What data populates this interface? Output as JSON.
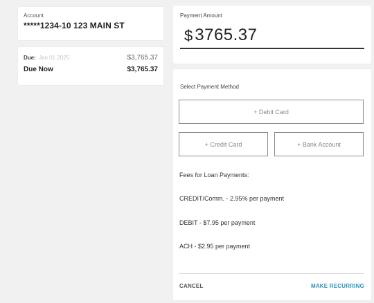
{
  "account": {
    "label": "Account",
    "value": "*****1234-10 123 MAIN ST"
  },
  "due": {
    "due_label": "Due:",
    "due_date": "Jan 01 2025",
    "due_amount": "$3,765.37",
    "due_now_label": "Due Now",
    "due_now_amount": "$3,765.37"
  },
  "payment_amount": {
    "label": "Payment Amount",
    "currency": "$",
    "value": "3765.37"
  },
  "payment_method": {
    "title": "Select Payment Method",
    "debit_button": "+ Debit Card",
    "credit_button": "+ Credit Card",
    "bank_button": "+ Bank Account"
  },
  "fees": {
    "title": "Fees for Loan Payments:",
    "credit": "CREDIT/Comm. - 2.95% per payment",
    "debit": "DEBIT - $7.95 per payment",
    "ach": "ACH - $2.95 per payment"
  },
  "footer": {
    "cancel": "CANCEL",
    "make_recurring": "MAKE RECURRING"
  },
  "colors": {
    "accent": "#2a93b8",
    "background": "#f1f1f1"
  }
}
